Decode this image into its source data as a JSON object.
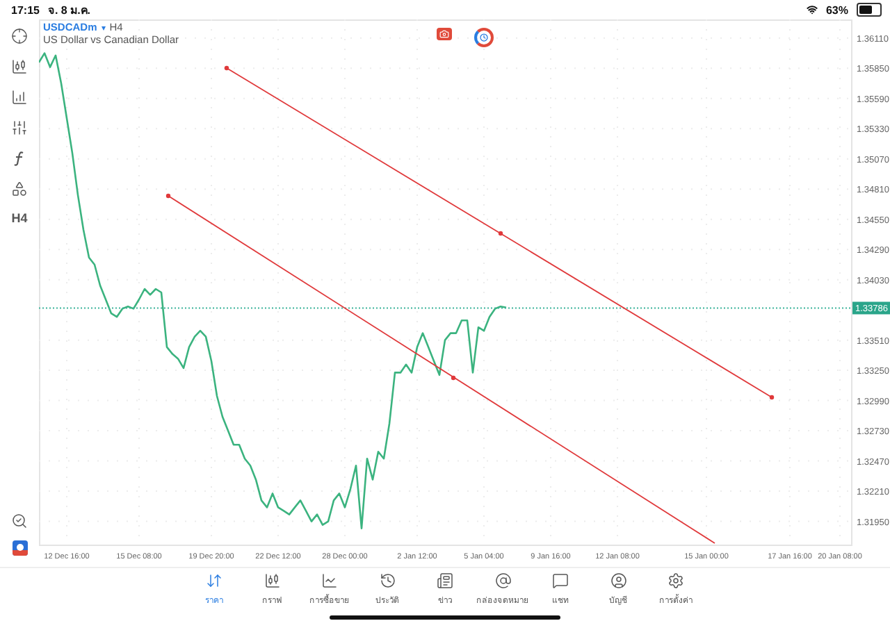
{
  "status_bar": {
    "time": "17:15",
    "date": "จ. 8 ม.ค.",
    "battery": "63%"
  },
  "toolbar": {
    "timeframe": "H4"
  },
  "header": {
    "symbol": "USDCADm",
    "caret": "▾",
    "timeframe": "H4",
    "description": "US Dollar vs Canadian Dollar"
  },
  "current_price": "1.33786",
  "chart_data": {
    "type": "line",
    "ylim": [
      1.3175,
      1.3627
    ],
    "grid": true,
    "categories": [
      null,
      null,
      null,
      null,
      null,
      "12 Dec 16:00",
      null,
      null,
      null,
      null,
      null,
      null,
      null,
      null,
      null,
      null,
      null,
      null,
      "15 Dec 08:00",
      null,
      null,
      null,
      null,
      null,
      null,
      null,
      null,
      null,
      null,
      null,
      null,
      "19 Dec 20:00",
      null,
      null,
      null,
      null,
      null,
      null,
      null,
      null,
      null,
      null,
      null,
      "22 Dec 12:00",
      null,
      null,
      null,
      null,
      null,
      null,
      null,
      null,
      null,
      null,
      null,
      "28 Dec 00:00",
      null,
      null,
      null,
      null,
      null,
      null,
      null,
      null,
      null,
      null,
      null,
      null,
      "2 Jan 12:00",
      null,
      null,
      null,
      null,
      null,
      null,
      null,
      null,
      null,
      null,
      null,
      "5 Jan 04:00",
      null,
      null,
      null,
      null,
      null,
      null,
      null,
      null,
      null,
      null,
      null,
      "9 Jan 16:00",
      null,
      null,
      null,
      null,
      null,
      null,
      null,
      null,
      null,
      null,
      null,
      "12 Jan 08:00",
      null,
      null,
      null,
      null,
      null,
      null,
      null,
      null,
      null,
      null,
      null,
      null,
      null,
      null,
      null,
      "15 Jan 00:00",
      null,
      null,
      null,
      null,
      null,
      null,
      null,
      null,
      null,
      null,
      null,
      null,
      null,
      null,
      "17 Jan 16:00",
      null,
      null,
      null,
      null,
      null,
      null,
      null,
      null,
      "20 Jan 08:00",
      null,
      null
    ],
    "series": [
      {
        "color": "#3bb37f",
        "values": [
          1.359,
          1.3598,
          1.3586,
          1.3596,
          1.3572,
          1.3542,
          1.3512,
          1.3476,
          1.3446,
          1.3422,
          1.3416,
          1.3398,
          1.3386,
          1.3374,
          1.3371,
          1.3378,
          1.338,
          1.3378,
          1.3386,
          1.3395,
          1.339,
          1.3395,
          1.3392,
          1.3345,
          1.3339,
          1.3335,
          1.3327,
          1.3345,
          1.3354,
          1.3359,
          1.3354,
          1.3333,
          1.3303,
          1.3285,
          1.3273,
          1.3261,
          1.3261,
          1.3249,
          1.3243,
          1.3231,
          1.3213,
          1.3207,
          1.3219,
          1.3207,
          1.3204,
          1.3201,
          1.3207,
          1.3213,
          1.3204,
          1.3195,
          1.3201,
          1.3192,
          1.3195,
          1.3213,
          1.3219,
          1.3207,
          1.3223,
          1.3243,
          1.3189,
          1.3249,
          1.3231,
          1.3255,
          1.3249,
          1.3279,
          1.3323,
          1.3323,
          1.333,
          1.3323,
          1.3345,
          1.3357,
          1.3345,
          1.3333,
          1.3321,
          1.3351,
          1.3357,
          1.3357,
          1.3368,
          1.3368,
          1.3323,
          1.3362,
          1.3359,
          1.3371,
          1.3378,
          1.338,
          1.3379,
          null,
          null,
          null,
          null,
          null,
          null,
          null,
          null,
          null,
          null,
          null,
          null,
          null,
          null,
          null,
          null,
          null,
          null,
          null,
          null,
          null,
          null,
          null,
          null,
          null,
          null,
          null,
          null,
          null,
          null,
          null,
          null,
          null,
          null,
          null,
          null,
          null,
          null,
          null,
          null,
          null,
          null,
          null,
          null,
          null,
          null,
          null,
          null,
          null,
          null,
          null,
          null,
          null,
          null,
          null,
          null,
          null,
          null,
          null,
          null,
          null,
          null
        ]
      }
    ],
    "yticks": [
      {
        "value": 1.3611,
        "label": "1.36110"
      },
      {
        "value": 1.3585,
        "label": "1.35850"
      },
      {
        "value": 1.3559,
        "label": "1.35590"
      },
      {
        "value": 1.3533,
        "label": "1.35330"
      },
      {
        "value": 1.3507,
        "label": "1.35070"
      },
      {
        "value": 1.3481,
        "label": "1.34810"
      },
      {
        "value": 1.3455,
        "label": "1.34550"
      },
      {
        "value": 1.3429,
        "label": "1.34290"
      },
      {
        "value": 1.3403,
        "label": "1.34030"
      },
      {
        "value": 1.3351,
        "label": "1.33510"
      },
      {
        "value": 1.3325,
        "label": "1.33250"
      },
      {
        "value": 1.3299,
        "label": "1.32990"
      },
      {
        "value": 1.3273,
        "label": "1.32730"
      },
      {
        "value": 1.3247,
        "label": "1.32470"
      },
      {
        "value": 1.3221,
        "label": "1.32210"
      },
      {
        "value": 1.3195,
        "label": "1.31950"
      }
    ]
  },
  "tabs": [
    {
      "label": "ราคา",
      "selected": true
    },
    {
      "label": "กราฟ",
      "selected": false
    },
    {
      "label": "การซื้อขาย",
      "selected": false
    },
    {
      "label": "ประวัติ",
      "selected": false
    },
    {
      "label": "ข่าว",
      "selected": false
    },
    {
      "label": "กล่องจดหมาย",
      "selected": false
    },
    {
      "label": "แชท",
      "selected": false
    },
    {
      "label": "บัญชี",
      "selected": false
    },
    {
      "label": "การตั้งค่า",
      "selected": false
    }
  ]
}
